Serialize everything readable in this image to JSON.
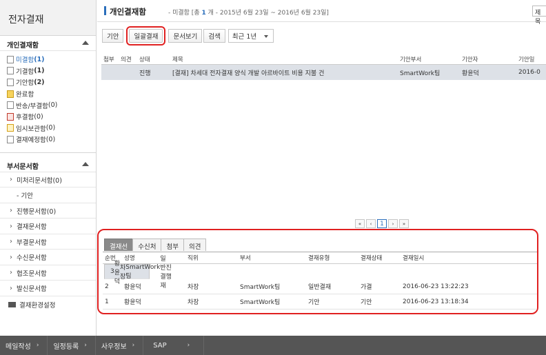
{
  "sidebar": {
    "title": "전자결재",
    "personal": {
      "label": "개인결재함",
      "items": [
        {
          "label": "미결함",
          "count": "(1)"
        },
        {
          "label": "기결함",
          "count": "(1)"
        },
        {
          "label": "기안함",
          "count": "(2)"
        },
        {
          "label": "완료함",
          "count": ""
        },
        {
          "label": "반송/부결함",
          "count": "(0)"
        },
        {
          "label": "후결함",
          "count": "(0)"
        },
        {
          "label": "임시보관함",
          "count": "(0)"
        },
        {
          "label": "결재예정함",
          "count": "(0)"
        }
      ]
    },
    "dept": {
      "label": "부서문서함",
      "items": [
        "미처리문서함(0)",
        "- 기안",
        "진행문서함(0)",
        "결재문서함",
        "부결문서함",
        "수신문서함",
        "협조문서함",
        "발신문서함"
      ]
    },
    "settings": "결재환경설정"
  },
  "header": {
    "title": "개인결재함",
    "sub_prefix": "- 미결함 [총",
    "count": "1",
    "sub_suffix": "개 - 2015년 6월 23일 ~ 2016년 6월 23일]",
    "right_tab": "제목"
  },
  "toolbar": {
    "draft": "기안",
    "bulk_approve": "일괄결재",
    "view_doc": "문서보기",
    "search": "검색",
    "period": "최근 1년"
  },
  "grid": {
    "columns": [
      "첨부",
      "의견",
      "상태",
      "제목",
      "기안부서",
      "기안자",
      "기안일"
    ],
    "rows": [
      {
        "attach": "",
        "opinion": "",
        "status": "진행",
        "title": "[결재] 차세대 전자결재 양식 개발 아르바이트 비용 지불 건",
        "dept": "SmartWork팀",
        "drafter": "황윤덕",
        "date": "2016-0"
      }
    ]
  },
  "pager": {
    "first": "«",
    "prev": "‹",
    "current": "1",
    "next": "›",
    "last": "»"
  },
  "detail": {
    "tabs": [
      "결재선",
      "수신처",
      "첨부",
      "의견"
    ],
    "columns": [
      "순번",
      "성명",
      "직위",
      "부서",
      "결재유형",
      "결재상태",
      "결재일시"
    ],
    "rows": [
      {
        "no": "3",
        "name": "황윤덕",
        "position": "차장",
        "dept": "SmartWork팀",
        "type": "일반결재",
        "state": "진행",
        "datetime": ""
      },
      {
        "no": "2",
        "name": "황윤덕",
        "position": "차장",
        "dept": "SmartWork팀",
        "type": "일반결재",
        "state": "가결",
        "datetime": "2016-06-23 13:22:23"
      },
      {
        "no": "1",
        "name": "황윤덕",
        "position": "차장",
        "dept": "SmartWork팀",
        "type": "기안",
        "state": "기안",
        "datetime": "2016-06-23 13:18:34"
      }
    ]
  },
  "bottombar": [
    "메일작성",
    "일정등록",
    "사우정보",
    "SAP"
  ],
  "colors": {
    "accent": "#2a6ebb",
    "highlight": "#e02020",
    "bottombar": "#555555"
  }
}
